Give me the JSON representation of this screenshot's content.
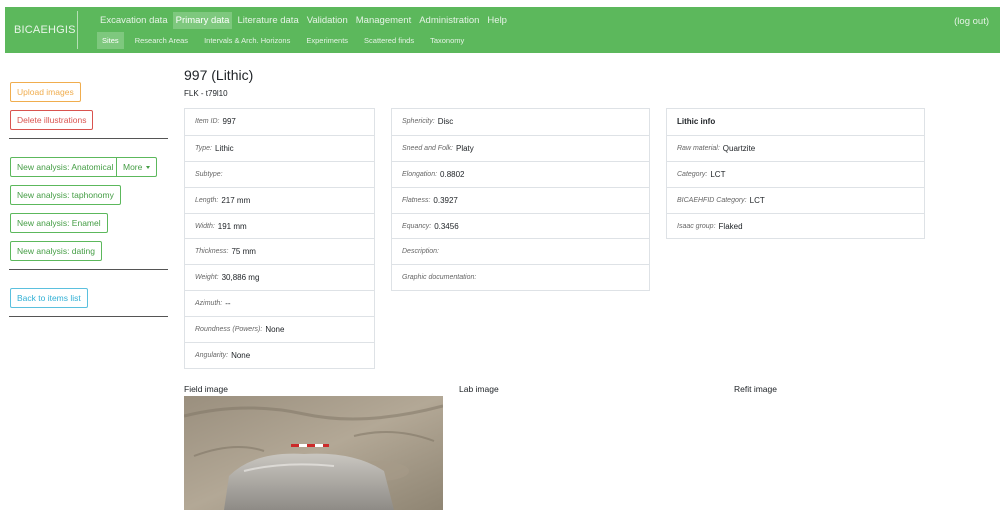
{
  "navbar": {
    "brand": "BICAEHGIS",
    "top_items": [
      "Excavation data",
      "Primary data",
      "Literature data",
      "Validation",
      "Management",
      "Administration",
      "Help"
    ],
    "active_top": 1,
    "sub_items": [
      "Sites",
      "Research Areas",
      "Intervals & Arch. Horizons",
      "Experiments",
      "Scattered finds",
      "Taxonomy"
    ],
    "active_sub": 0,
    "logout": "(log out)"
  },
  "sidebar": {
    "upload_images": "Upload images",
    "delete_illustrations": "Delete illustrations",
    "new_analysis_anatomical": "New analysis: Anatomical",
    "more": "More",
    "new_analysis_taphonomy": "New analysis: taphonomy",
    "new_analysis_enamel": "New analysis: Enamel",
    "new_analysis_dating": "New analysis: dating",
    "back_to_items": "Back to items list"
  },
  "item": {
    "title": "997 (Lithic)",
    "subtitle": "FLK - t79l10"
  },
  "table1": [
    {
      "key": "Item ID:",
      "value": "997"
    },
    {
      "key": "Type:",
      "value": "Lithic"
    },
    {
      "key": "Subtype:",
      "value": ""
    },
    {
      "key": "Length:",
      "value": "217 mm"
    },
    {
      "key": "Width:",
      "value": "191 mm"
    },
    {
      "key": "Thickness:",
      "value": "75 mm"
    },
    {
      "key": "Weight:",
      "value": "30,886 mg"
    },
    {
      "key": "Azimuth:",
      "value": "--"
    },
    {
      "key": "Roundness (Powers):",
      "value": "None"
    },
    {
      "key": "Angularity:",
      "value": "None"
    }
  ],
  "table2": [
    {
      "key": "Sphericity:",
      "value": "Disc"
    },
    {
      "key": "Sneed and Folk:",
      "value": "Platy"
    },
    {
      "key": "Elongation:",
      "value": "0.8802"
    },
    {
      "key": "Flatness:",
      "value": "0.3927"
    },
    {
      "key": "Equancy:",
      "value": "0.3456"
    },
    {
      "key": "Description:",
      "value": ""
    },
    {
      "key": "Graphic documentation:",
      "value": ""
    }
  ],
  "table3": {
    "heading": "Lithic info",
    "rows": [
      {
        "key": "Raw material:",
        "value": "Quartzite"
      },
      {
        "key": "Category:",
        "value": "LCT"
      },
      {
        "key": "BICAEHFID Category:",
        "value": "LCT"
      },
      {
        "key": "Isaac group:",
        "value": "Flaked"
      }
    ]
  },
  "images": {
    "field": "Field image",
    "lab": "Lab image",
    "refit": "Refit image"
  },
  "colors": {
    "navbar": "#5cb85c",
    "warning": "#f0ad4e",
    "danger": "#d9534f",
    "success": "#5cb85c",
    "info": "#5bc0de"
  }
}
